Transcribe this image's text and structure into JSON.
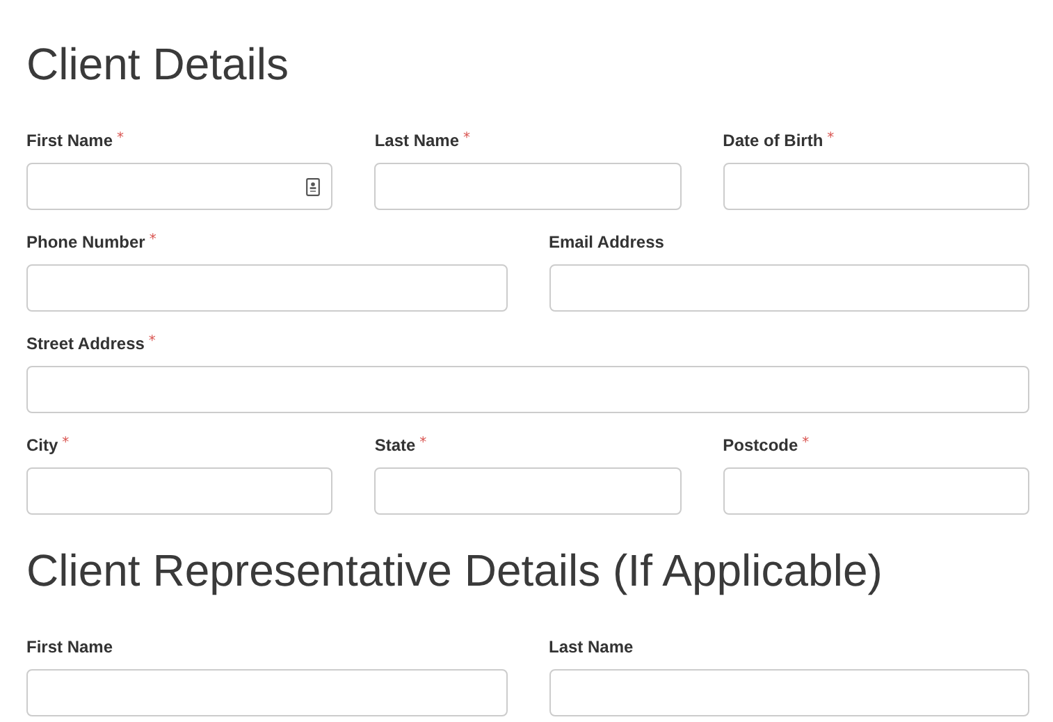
{
  "sections": [
    {
      "title": "Client Details",
      "rows": [
        [
          {
            "label": "First Name",
            "marker": "*",
            "autofill_icon": true
          },
          {
            "label": "Last Name",
            "marker": "*"
          },
          {
            "label": "Date of Birth",
            "marker": "*"
          }
        ],
        [
          {
            "label": "Phone Number",
            "marker": "*"
          },
          {
            "label": "Email Address"
          }
        ],
        [
          {
            "label": "Street Address",
            "marker": "*"
          }
        ],
        [
          {
            "label": "City",
            "marker": "*"
          },
          {
            "label": "State",
            "marker": "*"
          },
          {
            "label": "Postcode",
            "marker": "*"
          }
        ]
      ]
    },
    {
      "title": "Client Representative Details (If Applicable)",
      "rows": [
        [
          {
            "label": "First Name"
          },
          {
            "label": "Last Name"
          }
        ]
      ]
    }
  ]
}
